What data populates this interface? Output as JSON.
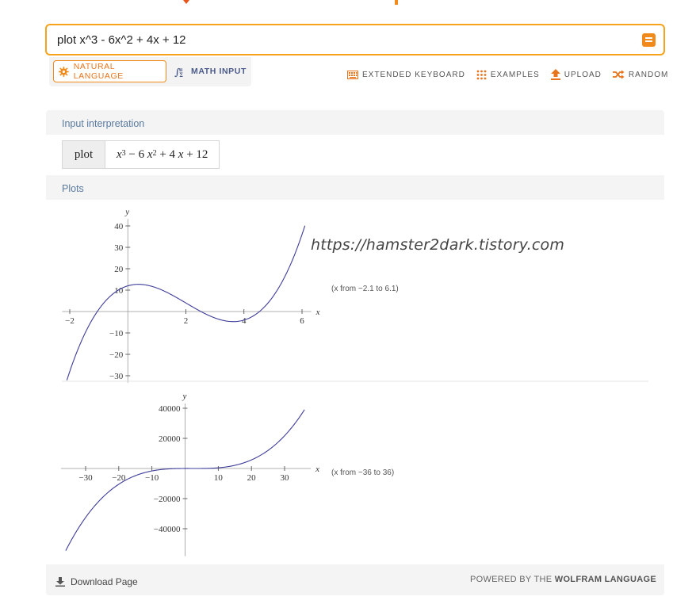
{
  "search": {
    "query": "plot x^3 - 6x^2 + 4x + 12"
  },
  "input_modes": [
    {
      "label": "NATURAL LANGUAGE",
      "active": true
    },
    {
      "label": "MATH INPUT",
      "active": false
    }
  ],
  "toolbar": {
    "extended_keyboard": "EXTENDED KEYBOARD",
    "examples": "EXAMPLES",
    "upload": "UPLOAD",
    "random": "RANDOM"
  },
  "pods": {
    "interpretation_title": "Input interpretation",
    "interpretation_label": "plot",
    "plots_title": "Plots"
  },
  "watermark": "https://hamster2dark.tistory.com",
  "footer": {
    "download": "Download Page",
    "powered_prefix": "POWERED BY THE ",
    "powered_brand": "WOLFRAM LANGUAGE"
  },
  "colors": {
    "accent": "#f28a1b",
    "curve": "#3f3d99",
    "pod_title": "#5a7a9e"
  },
  "chart_data": [
    {
      "type": "line",
      "function": "x^3 - 6x^2 + 4x + 12",
      "xlabel": "x",
      "ylabel": "y",
      "xlim": [
        -2.1,
        6.1
      ],
      "ylim": [
        -31,
        41
      ],
      "range_note": "(x from −2.1 to 6.1)",
      "x_ticks": [
        -2,
        2,
        4,
        6
      ],
      "x_tick_labels": [
        "−2",
        "2",
        "4",
        "6"
      ],
      "y_ticks": [
        -30,
        -20,
        -10,
        10,
        20,
        30,
        40
      ],
      "y_tick_labels": [
        "−30",
        "−20",
        "−10",
        "10",
        "20",
        "30",
        "40"
      ]
    },
    {
      "type": "line",
      "function": "x^3 - 6x^2 + 4x + 12",
      "xlabel": "x",
      "ylabel": "y",
      "xlim": [
        -36,
        36
      ],
      "ylim": [
        -55000,
        40000
      ],
      "range_note": "(x from −36 to 36)",
      "x_ticks": [
        -30,
        -20,
        -10,
        10,
        20,
        30
      ],
      "x_tick_labels": [
        "−30",
        "−20",
        "−10",
        "10",
        "20",
        "30"
      ],
      "y_ticks": [
        -40000,
        -20000,
        20000,
        40000
      ],
      "y_tick_labels": [
        "−40000",
        "−20000",
        "20000",
        "40000"
      ]
    }
  ]
}
